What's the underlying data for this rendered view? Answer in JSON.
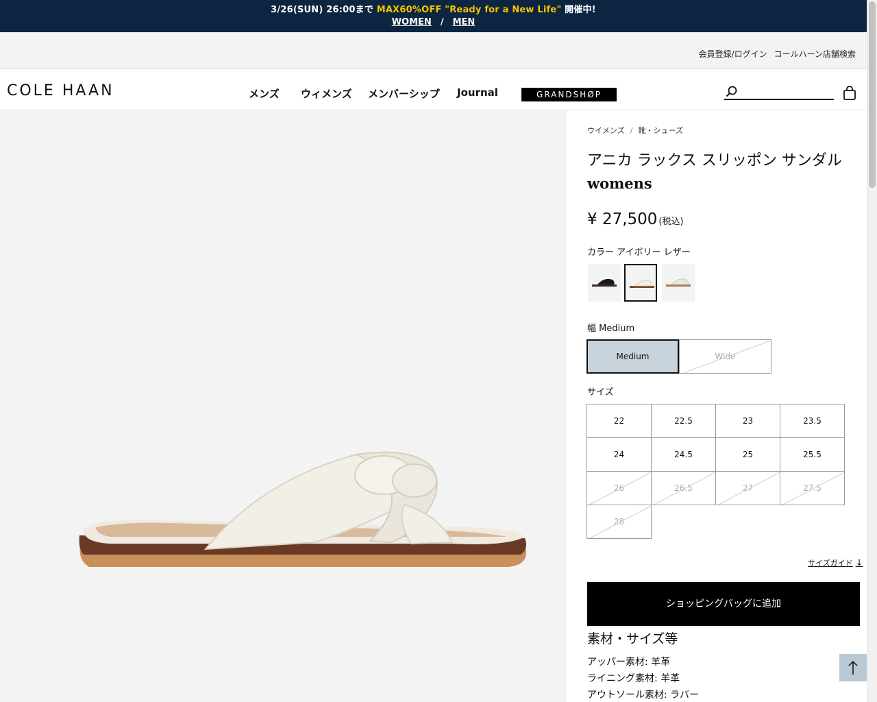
{
  "promo": {
    "date_text": "3/26(SUN) 26:00まで ",
    "highlight_text": "MAX60%OFF \"Ready for a New Life\"",
    "suffix_text": " 開催中!",
    "women_link": "WOMEN",
    "separator": "/",
    "men_link": "MEN",
    "highlight_color": "#f5c400"
  },
  "utility": {
    "login": "会員登録/ログイン",
    "store_search": "コールハーン店舗検索"
  },
  "header": {
    "logo": "COLE HAAN",
    "nav": [
      "メンズ",
      "ウィメンズ",
      "メンバーシップ",
      "Journal"
    ],
    "grandshop": "GRANDSHØP"
  },
  "product": {
    "breadcrumb": [
      "ウイメンズ",
      "靴・シューズ"
    ],
    "breadcrumb_sep": "/",
    "title": "アニカ ラックス スリッポン サンダル",
    "subtitle": "womens",
    "price": "¥ 27,500",
    "tax_note": "(税込)",
    "color_label": "カラー アイボリー レザー",
    "swatches": [
      {
        "name": "black",
        "color": "#1a1a1a"
      },
      {
        "name": "ivory",
        "color": "#ece8df"
      },
      {
        "name": "light",
        "color": "#e4e2da"
      }
    ],
    "width_label": "幅 Medium",
    "widths": [
      {
        "label": "Medium",
        "selected": true,
        "disabled": false
      },
      {
        "label": "Wide",
        "selected": false,
        "disabled": true
      }
    ],
    "size_label": "サイズ",
    "sizes": [
      {
        "label": "22",
        "disabled": false
      },
      {
        "label": "22.5",
        "disabled": false
      },
      {
        "label": "23",
        "disabled": false
      },
      {
        "label": "23.5",
        "disabled": false
      },
      {
        "label": "24",
        "disabled": false
      },
      {
        "label": "24.5",
        "disabled": false
      },
      {
        "label": "25",
        "disabled": false
      },
      {
        "label": "25.5",
        "disabled": false
      },
      {
        "label": "26",
        "disabled": true
      },
      {
        "label": "26.5",
        "disabled": true
      },
      {
        "label": "27",
        "disabled": true
      },
      {
        "label": "27.5",
        "disabled": true
      },
      {
        "label": "28",
        "disabled": true
      }
    ],
    "size_guide": "サイズガイド",
    "size_guide_arrow": "↓",
    "add_to_bag": "ショッピングバッグに追加",
    "materials_heading": "素材・サイズ等",
    "materials": [
      "アッパー素材: 羊革",
      "ライニング素材: 羊革",
      "アウトソール素材: ラバー"
    ]
  }
}
